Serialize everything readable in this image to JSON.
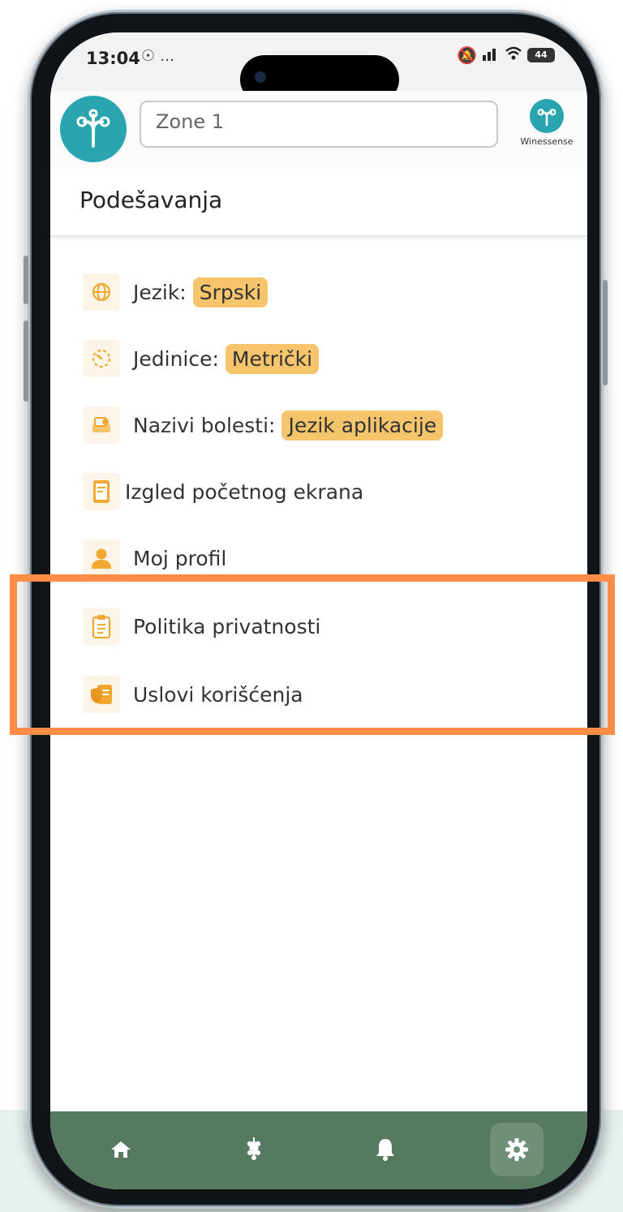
{
  "status_bar": {
    "time": "13:04",
    "extra": "☉ ...",
    "battery": "44"
  },
  "header": {
    "zone_value": "Zone 1",
    "brand_name": "Winessense"
  },
  "page": {
    "title": "Podešavanja"
  },
  "settings": {
    "language": {
      "label": "Jezik:",
      "value": "Srpski"
    },
    "units": {
      "label": "Jedinice:",
      "value": "Metrički"
    },
    "disease_names": {
      "label": "Nazivi bolesti:",
      "value": "Jezik aplikacije"
    },
    "home_layout": {
      "label": "Izgled početnog ekrana"
    },
    "profile": {
      "label": "Moj profil"
    },
    "privacy": {
      "label": "Politika privatnosti"
    },
    "terms": {
      "label": "Uslovi korišćenja"
    }
  },
  "colors": {
    "accent": "#f6c46a",
    "brand_teal": "#2aa5b0",
    "nav_bg": "#567a60",
    "highlight": "#ff8c47"
  },
  "bottom_nav": {
    "items": [
      "home-icon",
      "grapes-icon",
      "bell-icon",
      "gear-icon"
    ],
    "active": "gear-icon"
  }
}
